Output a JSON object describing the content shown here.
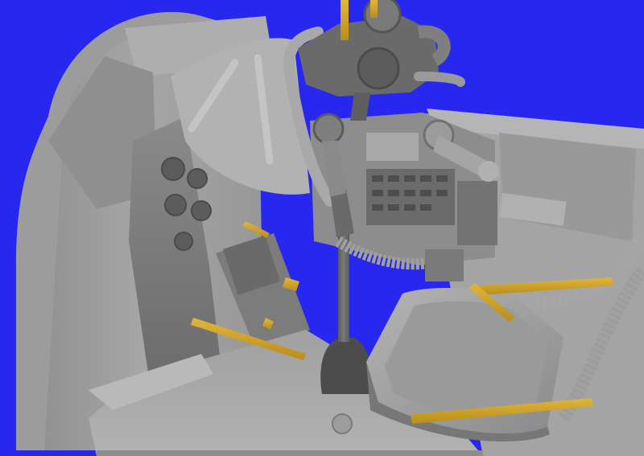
{
  "image": {
    "subject": "",
    "colors": {
      "background": "#2727f0",
      "gray_light": "#a3a3a3",
      "gray_mid": "#8e8e8e",
      "gray_dark": "#6e6e6e",
      "gray_shadow": "#545454",
      "yellow_part": "#d3a82a"
    }
  }
}
